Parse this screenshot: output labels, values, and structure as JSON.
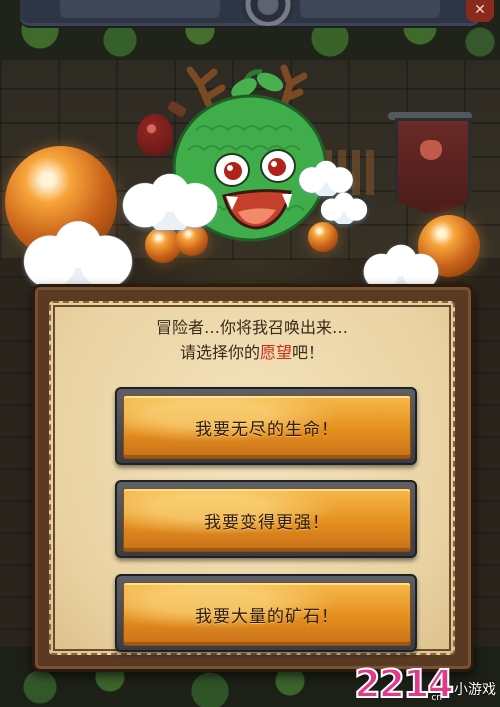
{
  "dialog": {
    "prompt_line1": "冒险者…你将我召唤出来…",
    "prompt_line2_before": "请选择你的",
    "prompt_line2_highlight": "愿望",
    "prompt_line2_after": "吧！",
    "highlight_color": "#cc2a1a"
  },
  "choices": [
    {
      "label": "我要无尽的生命！"
    },
    {
      "label": "我要变得更强！"
    },
    {
      "label": "我要大量的矿石！"
    }
  ],
  "hud": {
    "close_icon": "close-icon"
  },
  "watermark": {
    "digits": "2214",
    "site": "小游戏",
    "domain": "cn"
  },
  "colors": {
    "button_gold": "#e48f1e",
    "panel_parchment": "#ead3a3",
    "panel_frame": "#5a3a22",
    "monster_green": "#3fae4a"
  }
}
